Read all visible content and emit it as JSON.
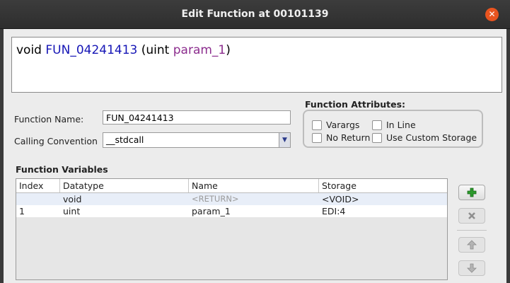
{
  "window": {
    "title": "Edit Function at 00101139"
  },
  "signature": {
    "return_type": "void",
    "function_name": "FUN_04241413",
    "open": "(",
    "param_type": "uint",
    "param_name": "param_1",
    "close": ")"
  },
  "form": {
    "function_name_label": "Function Name:",
    "function_name_value": "FUN_04241413",
    "calling_convention_label": "Calling Convention",
    "calling_convention_value": "__stdcall"
  },
  "attributes": {
    "title": "Function Attributes:",
    "varargs": "Varargs",
    "in_line": "In Line",
    "no_return": "No Return",
    "use_custom_storage": "Use Custom Storage"
  },
  "variables": {
    "title": "Function Variables",
    "columns": [
      "Index",
      "Datatype",
      "Name",
      "Storage"
    ],
    "rows": [
      {
        "index": "",
        "datatype": "void",
        "name": "<RETURN>",
        "storage": "<VOID>"
      },
      {
        "index": "1",
        "datatype": "uint",
        "name": "param_1",
        "storage": "EDI:4"
      }
    ]
  },
  "icons": {
    "close": "close-icon",
    "add": "plus-icon",
    "remove": "x-icon",
    "up": "arrow-up-icon",
    "down": "arrow-down-icon"
  }
}
